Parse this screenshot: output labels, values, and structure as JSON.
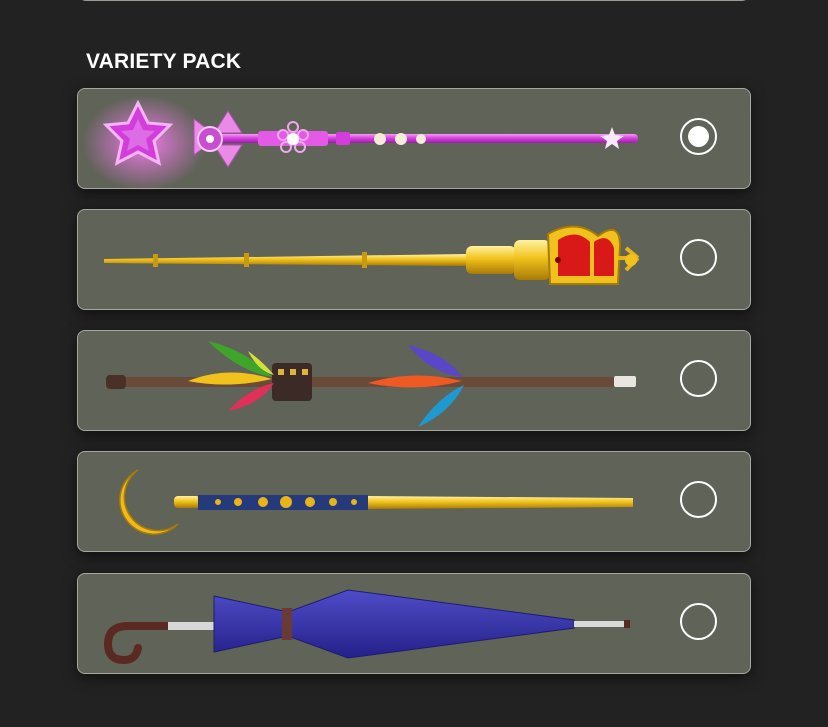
{
  "section": {
    "title": "VARIETY PACK"
  },
  "options": [
    {
      "item": "pink-star-wand",
      "selected": true
    },
    {
      "item": "golden-crown-scepter",
      "selected": false
    },
    {
      "item": "feathered-staff",
      "selected": false
    },
    {
      "item": "crescent-moon-staff",
      "selected": false
    },
    {
      "item": "blue-umbrella",
      "selected": false
    }
  ],
  "colors": {
    "background": "#222223",
    "card": "#5f6358",
    "card_border": "#a6a89f",
    "radio": "#ffffff",
    "wand_pink": "#d63ce0",
    "gold": "#f2c21c",
    "crown_red": "#d91818",
    "staff_brown": "#6b4a3a",
    "moon_navy": "#253a7a",
    "umbrella_blue": "#3a37a8"
  }
}
